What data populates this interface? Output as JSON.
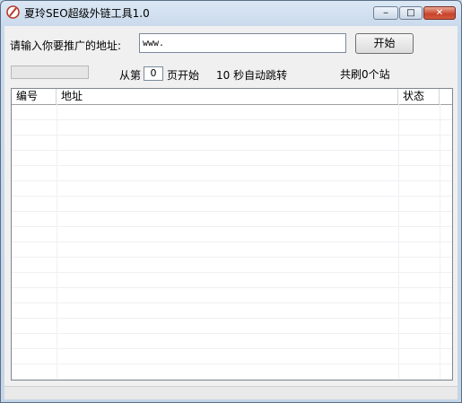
{
  "window": {
    "title": "夏玲SEO超级外链工具1.0",
    "minimize_glyph": "─",
    "maximize_glyph": "□",
    "close_glyph": "✕"
  },
  "form": {
    "url_label": "请输入你要推广的地址:",
    "url_value": "www.",
    "start_label": "开始"
  },
  "controls": {
    "progress_fraction": 0,
    "from_label": "从第",
    "page_value": "0",
    "page_suffix": "页开始",
    "auto_jump": "10 秒自动跳转",
    "total_sites": "共刷0个站"
  },
  "table": {
    "columns": [
      "编号",
      "地址",
      "状态"
    ],
    "rows": []
  }
}
